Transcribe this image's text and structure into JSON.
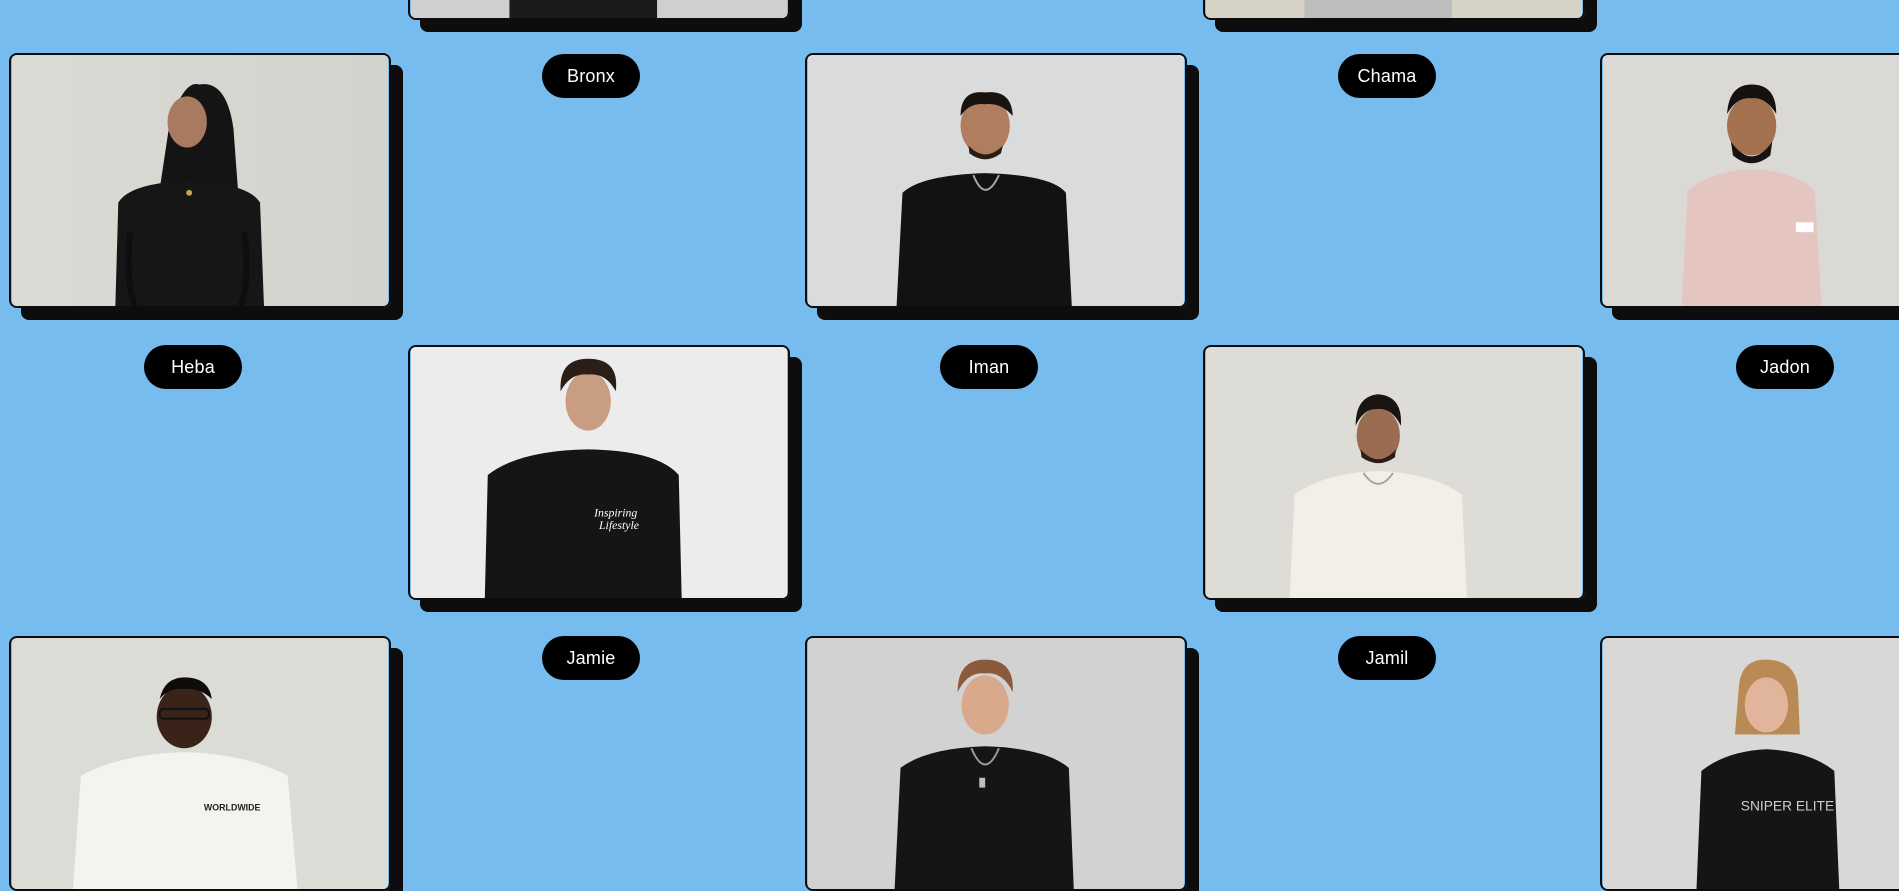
{
  "page": {
    "background": "#76bcef",
    "accent": "#000000"
  },
  "people": [
    {
      "id": "bronx",
      "name": "Bronx"
    },
    {
      "id": "chama",
      "name": "Chama"
    },
    {
      "id": "heba",
      "name": "Heba"
    },
    {
      "id": "iman",
      "name": "Iman"
    },
    {
      "id": "jadon",
      "name": "Jadon"
    },
    {
      "id": "jamie",
      "name": "Jamie",
      "shirt_text": [
        "Inspiring",
        "Lifestyle"
      ]
    },
    {
      "id": "jamil",
      "name": "Jamil"
    },
    {
      "id": "person-row3-col1",
      "shirt_text": [
        "WORLDWIDE"
      ]
    },
    {
      "id": "person-row3-col3"
    },
    {
      "id": "person-row3-col5",
      "shirt_text": [
        "SNIPER ELITE"
      ]
    }
  ]
}
